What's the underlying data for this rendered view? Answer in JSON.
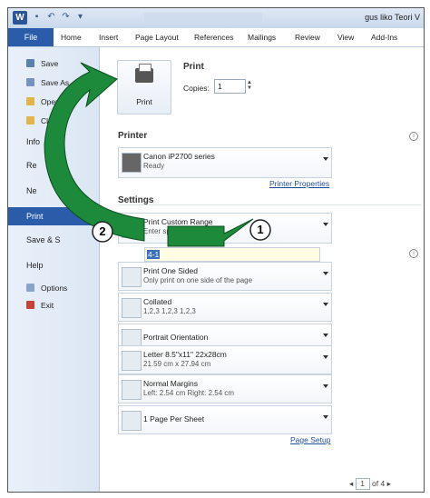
{
  "titlebar": {
    "app_logo": "W",
    "user_title": "gus liko Teori V"
  },
  "ribbon": {
    "tabs": [
      "File",
      "Home",
      "Insert",
      "Page Layout",
      "References",
      "Mailings",
      "Review",
      "View",
      "Add-Ins"
    ]
  },
  "leftnav": {
    "items": [
      {
        "label": "Save",
        "icon": "save-icon"
      },
      {
        "label": "Save As",
        "icon": "save-as-icon"
      },
      {
        "label": "Open",
        "icon": "open-folder-icon"
      },
      {
        "label": "Cl",
        "icon": "close-icon"
      },
      {
        "label": "Info",
        "icon": ""
      },
      {
        "label": "Re",
        "icon": ""
      },
      {
        "label": "Ne",
        "icon": ""
      },
      {
        "label": "Print",
        "icon": ""
      },
      {
        "label": "Save & S",
        "icon": ""
      },
      {
        "label": "Help",
        "icon": ""
      },
      {
        "label": "Options",
        "icon": "options-icon"
      },
      {
        "label": "Exit",
        "icon": "exit-icon"
      }
    ]
  },
  "print": {
    "button_label": "Print",
    "heading": "Print",
    "copies_label": "Copies:",
    "copies_value": "1"
  },
  "printer": {
    "heading": "Printer",
    "name": "Canon iP2700 series",
    "status": "Ready",
    "properties_link": "Printer Properties"
  },
  "settings": {
    "heading": "Settings",
    "range_title": "Print Custom Range",
    "range_sub": "Enter specific pa",
    "pages_label": "s:",
    "pages_value": "4-1",
    "sided_title": "Print One Sided",
    "sided_sub": "Only print on one side of the page",
    "collated_title": "Collated",
    "collated_sub": "1,2,3    1,2,3    1,2,3",
    "orientation": "Portrait Orientation",
    "paper_title": "Letter 8.5\"x11\" 22x28cm",
    "paper_sub": "21.59 cm x 27.94 cm",
    "margins_title": "Normal Margins",
    "margins_sub": "Left:  2.54 cm    Right:  2.54 cm",
    "per_sheet": "1 Page Per Sheet",
    "page_setup_link": "Page Setup"
  },
  "pager": {
    "current": "1",
    "of_text": "of 4"
  },
  "annotations": {
    "step1": "1",
    "step2": "2"
  },
  "colors": {
    "accent": "#2a5caa",
    "arrow": "#1d8a3b"
  }
}
